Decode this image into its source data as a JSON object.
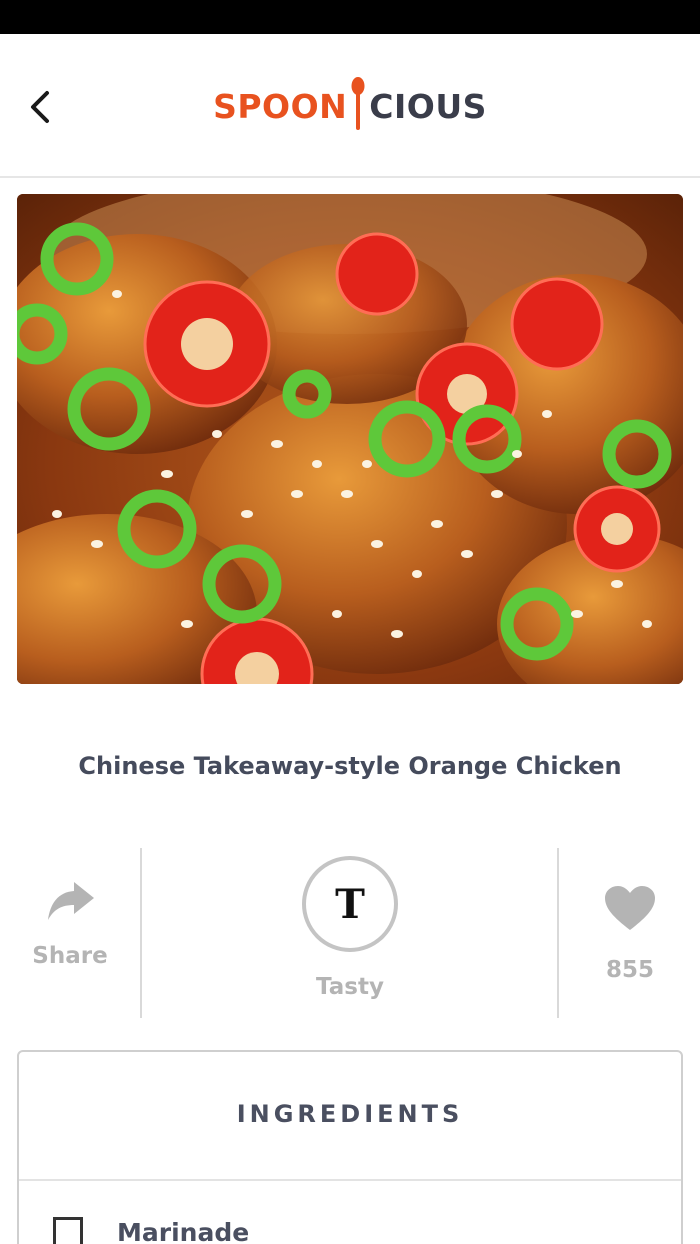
{
  "header": {
    "logo_left": "SPOON",
    "logo_right": "CIOUS",
    "back_icon": "chevron-left-icon"
  },
  "colors": {
    "brand_orange": "#e8521f",
    "brand_dark": "#3a3d4a",
    "muted_gray": "#b4b4b4"
  },
  "hero": {
    "icon": "food-photo"
  },
  "recipe": {
    "title": "Chinese Takeaway-style Orange Chicken"
  },
  "actions": {
    "share_label": "Share",
    "share_icon": "share-arrow-icon",
    "author_initial": "T",
    "author_name": "Tasty",
    "like_icon": "heart-icon",
    "like_count": "855"
  },
  "ingredients": {
    "heading": "INGREDIENTS",
    "items": [
      {
        "label": "Marinade",
        "checked": false
      }
    ]
  }
}
